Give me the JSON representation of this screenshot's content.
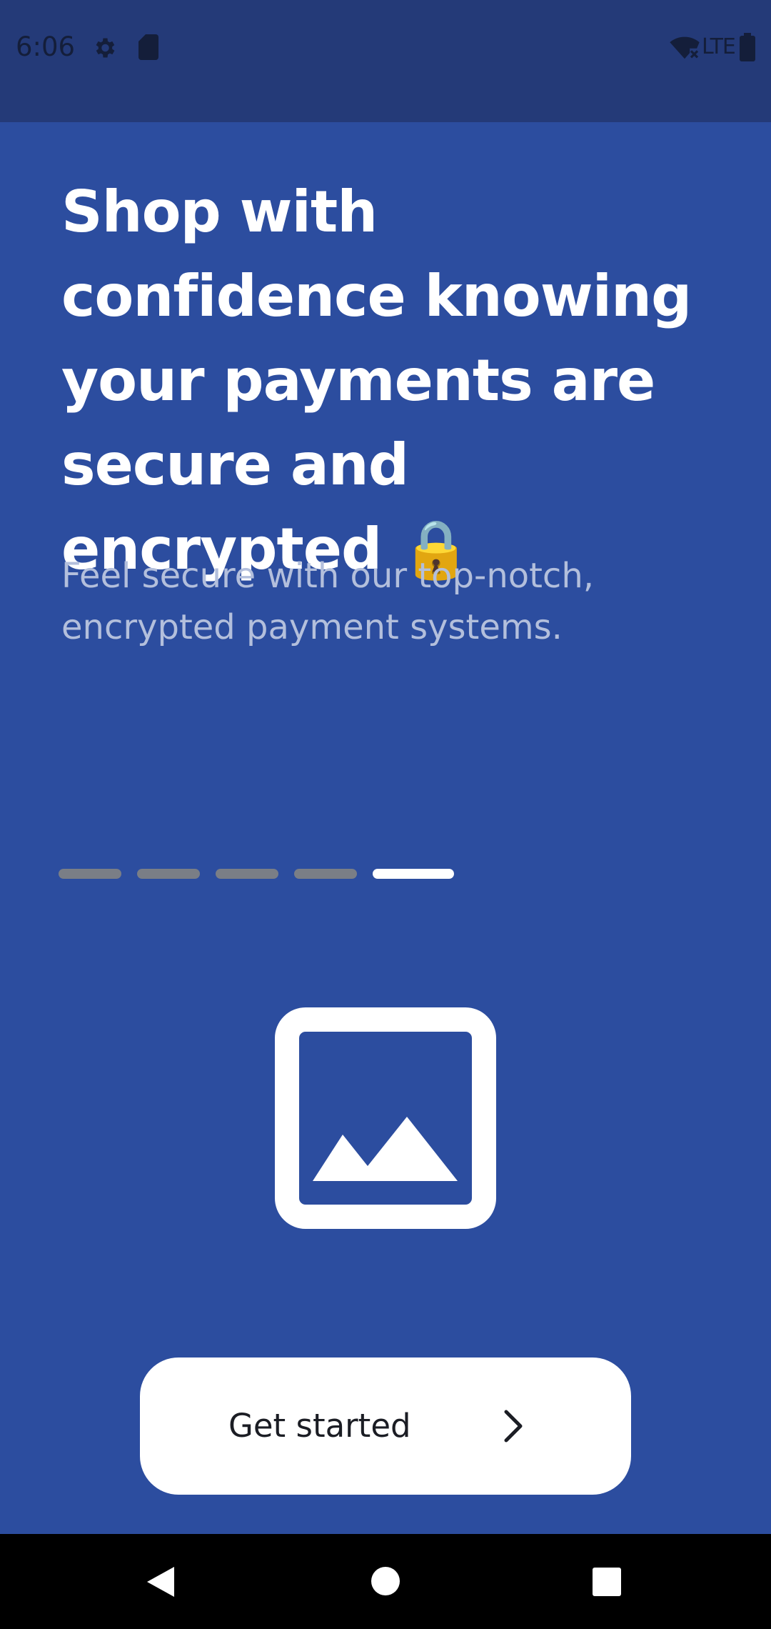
{
  "status_bar": {
    "time": "6:06",
    "network_label": "LTE",
    "icons": [
      "settings-icon",
      "sd-card-icon",
      "wifi-off-icon",
      "battery-icon"
    ]
  },
  "onboarding": {
    "headline": "Shop with confidence knowing your payments are secure and encrypted 🔒",
    "subtitle": "Feel secure with our top-notch, encrypted payment systems.",
    "page_indicator": {
      "total": 5,
      "current": 5
    },
    "image_icon": "image-placeholder-icon"
  },
  "cta": {
    "label": "Get started",
    "icon": "chevron-right-icon"
  },
  "nav_bar": {
    "icons": [
      "back-icon",
      "home-icon",
      "recents-icon"
    ]
  },
  "colors": {
    "background": "#2c4d9f",
    "status_bar": "#243a78",
    "headline": "#ffffff",
    "subtitle": "#b3bfdc",
    "indicator_inactive": "#7a7e86",
    "indicator_active": "#ffffff",
    "button_bg": "#ffffff",
    "button_text": "#1b1d24"
  }
}
